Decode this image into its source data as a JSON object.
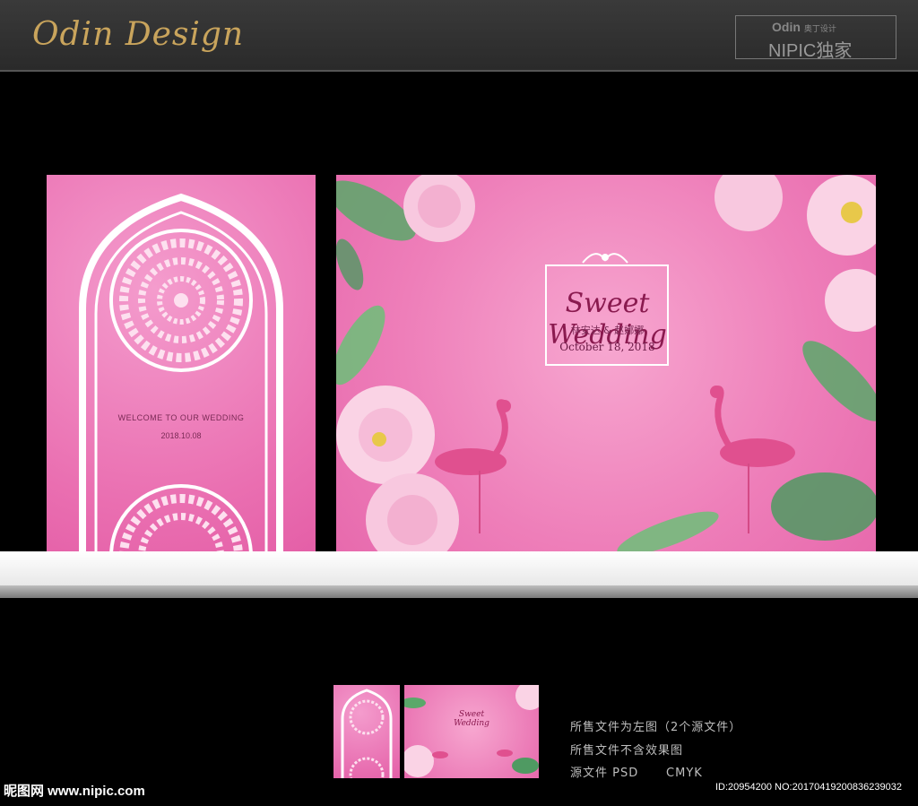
{
  "header": {
    "logo": "Odin Design",
    "badge_line1": "Odin",
    "badge_line1_small": "奥丁设计",
    "badge_line2": "NIPIC独家"
  },
  "left_panel": {
    "welcome": "WELCOME TO OUR WEDDING",
    "date": "2018.10.08"
  },
  "right_panel": {
    "title": "Sweet Wedding",
    "names": "林安达 & 赵娜娜",
    "date": "October 18, 2018"
  },
  "thumbnail": {
    "title": "Sweet Wedding"
  },
  "info": {
    "line1": "所售文件为左图（2个源文件）",
    "line2": "所售文件不含效果图",
    "line3": "源文件 PSD      CMYK"
  },
  "footer": {
    "site": "昵图网 www.nipic.com",
    "id": "ID:20954200 NO:20170419200836239032"
  },
  "colors": {
    "pink_light": "#f7a7d0",
    "pink_deep": "#e45fa7",
    "gold": "#c9a45c"
  }
}
